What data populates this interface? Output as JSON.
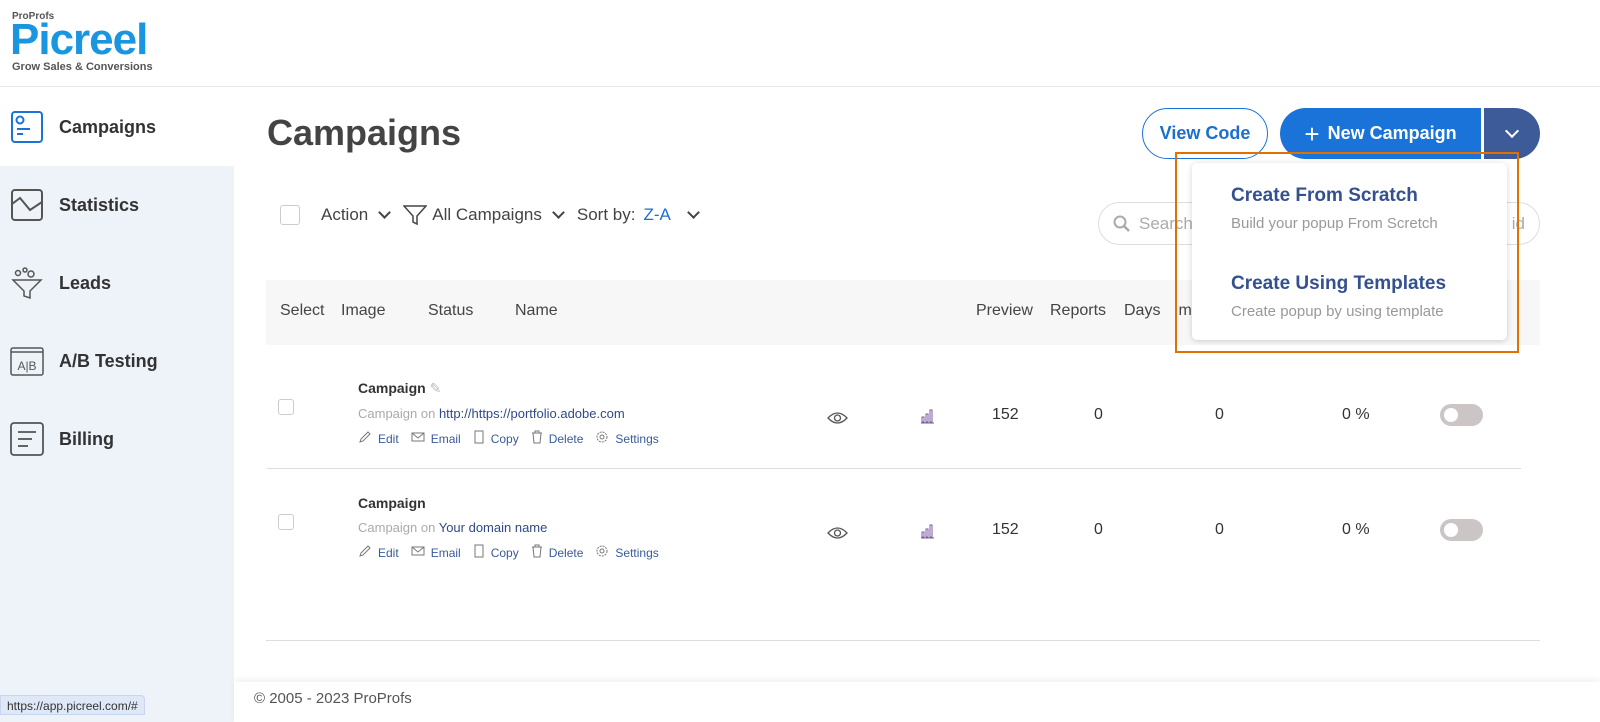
{
  "brand": {
    "small": "ProProfs",
    "name": "Picreel",
    "tagline": "Grow Sales & Conversions",
    "color": "#1a95e0"
  },
  "sidebar": {
    "items": [
      {
        "label": "Campaigns",
        "icon": "campaign-icon",
        "active": true
      },
      {
        "label": "Statistics",
        "icon": "chart-icon"
      },
      {
        "label": "Leads",
        "icon": "funnel-icon"
      },
      {
        "label": "A/B Testing",
        "icon": "ab-test-icon"
      },
      {
        "label": "Billing",
        "icon": "billing-icon"
      }
    ]
  },
  "page": {
    "title": "Campaigns"
  },
  "buttons": {
    "view_code": "View Code",
    "new_campaign": "New Campaign"
  },
  "toolbar": {
    "action": "Action",
    "filter": "All Campaigns",
    "sort_label": "Sort by:",
    "sort_value": "Z-A",
    "search_placeholder": "Search",
    "search_trailing": "id"
  },
  "table": {
    "headers": [
      "Select",
      "Image",
      "Status",
      "Name",
      "Preview",
      "Reports",
      "Days",
      "Im"
    ],
    "rows": [
      {
        "name": "Campaign",
        "on_label": "Campaign on",
        "url": "http://https://portfolio.adobe.com",
        "v1": "152",
        "v2": "0",
        "v3": "0",
        "v4": "0 %",
        "enabled": false
      },
      {
        "name": "Campaign",
        "on_label": "Campaign on",
        "url": "Your domain name",
        "v1": "152",
        "v2": "0",
        "v3": "0",
        "v4": "0 %",
        "enabled": false
      }
    ],
    "actions": [
      "Edit",
      "Email",
      "Copy",
      "Delete",
      "Settings"
    ]
  },
  "dropdown": {
    "items": [
      {
        "title": "Create From Scratch",
        "subtitle": "Build your popup From Scretch"
      },
      {
        "title": "Create Using Templates",
        "subtitle": "Create popup by using template"
      }
    ],
    "highlight_color": "#e07000"
  },
  "footer": {
    "copyright": "© 2005 - 2023 ProProfs"
  },
  "status_bar": {
    "url": "https://app.picreel.com/#"
  },
  "colors": {
    "primary": "#1a73d9",
    "dropdown_button": "#3d5a99",
    "sidebar_bg": "#eef3f9"
  }
}
